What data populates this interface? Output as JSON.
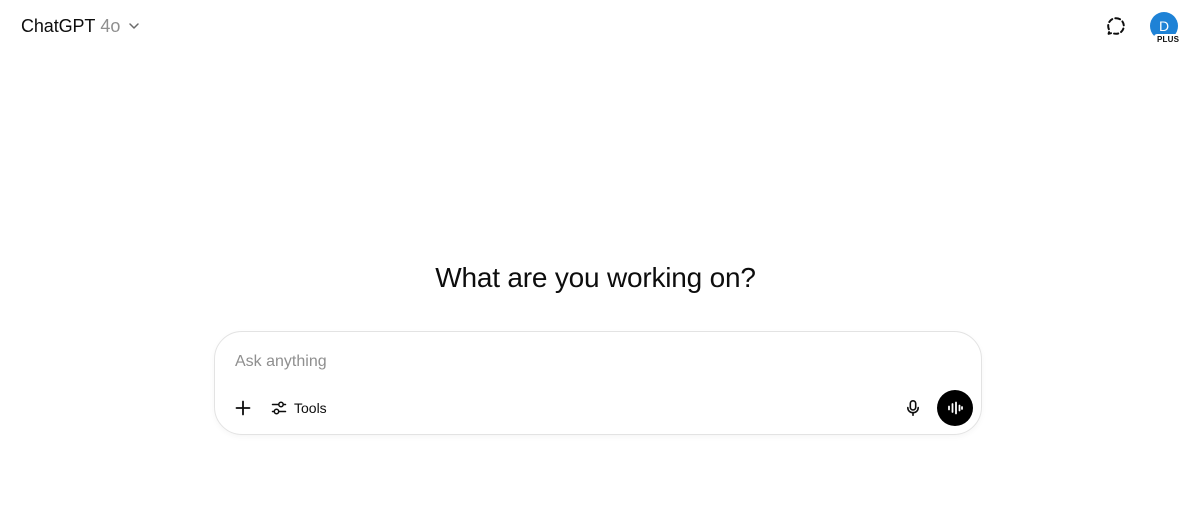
{
  "header": {
    "model_name": "ChatGPT",
    "model_version": "4o",
    "chevron_icon": "chevron-down-icon",
    "temporary_chat_icon": "dashed-chat-bubble-icon",
    "avatar_initial": "D",
    "plan_badge": "PLUS",
    "avatar_color": "#1e82d6"
  },
  "main": {
    "headline": "What are you working on?"
  },
  "composer": {
    "placeholder": "Ask anything",
    "value": "",
    "attach_icon": "plus-icon",
    "tools_icon": "sliders-icon",
    "tools_label": "Tools",
    "mic_icon": "microphone-icon",
    "voice_icon": "voice-waveform-icon",
    "voice_button_color": "#000000"
  }
}
